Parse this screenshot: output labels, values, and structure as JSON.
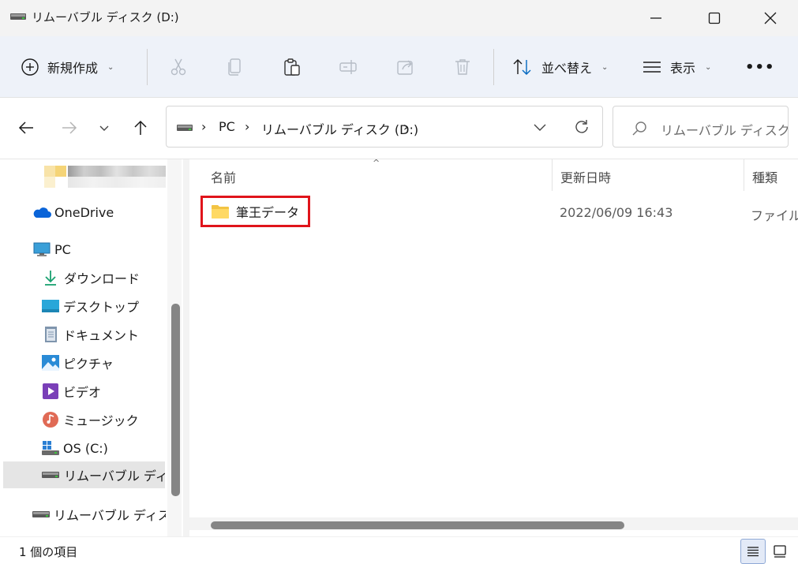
{
  "window": {
    "title": "リムーバブル ディスク (D:)"
  },
  "toolbar": {
    "new_label": "新規作成",
    "sort_label": "並べ替え",
    "view_label": "表示",
    "more_label": "•••"
  },
  "address": {
    "crumbs": [
      "PC",
      "リムーバブル ディスク (D:)"
    ],
    "search_placeholder": "リムーバブル ディスク (..."
  },
  "sidebar": {
    "items": [
      {
        "label": "OneDrive",
        "icon": "onedrive-icon"
      },
      {
        "label": "PC",
        "icon": "pc-icon"
      },
      {
        "label": "ダウンロード",
        "icon": "download-icon"
      },
      {
        "label": "デスクトップ",
        "icon": "desktop-icon"
      },
      {
        "label": "ドキュメント",
        "icon": "document-icon"
      },
      {
        "label": "ピクチャ",
        "icon": "picture-icon"
      },
      {
        "label": "ビデオ",
        "icon": "video-icon"
      },
      {
        "label": "ミュージック",
        "icon": "music-icon"
      },
      {
        "label": "OS (C:)",
        "icon": "os-drive-icon"
      },
      {
        "label": "リムーバブル ディスク",
        "icon": "removable-drive-icon",
        "selected": true
      },
      {
        "label": "リムーバブル ディスク",
        "icon": "removable-drive-icon"
      }
    ]
  },
  "columns": {
    "name": "名前",
    "modified": "更新日時",
    "type": "種類"
  },
  "files": [
    {
      "name": "筆王データ",
      "modified": "2022/06/09 16:43",
      "type": "ファイル フ",
      "icon": "folder-icon",
      "highlighted": true
    }
  ],
  "status": {
    "item_count": "1 個の項目"
  },
  "colors": {
    "highlight_border": "#e0141b",
    "command_bar_bg": "#eef2f9",
    "accent": "#0067c0"
  }
}
